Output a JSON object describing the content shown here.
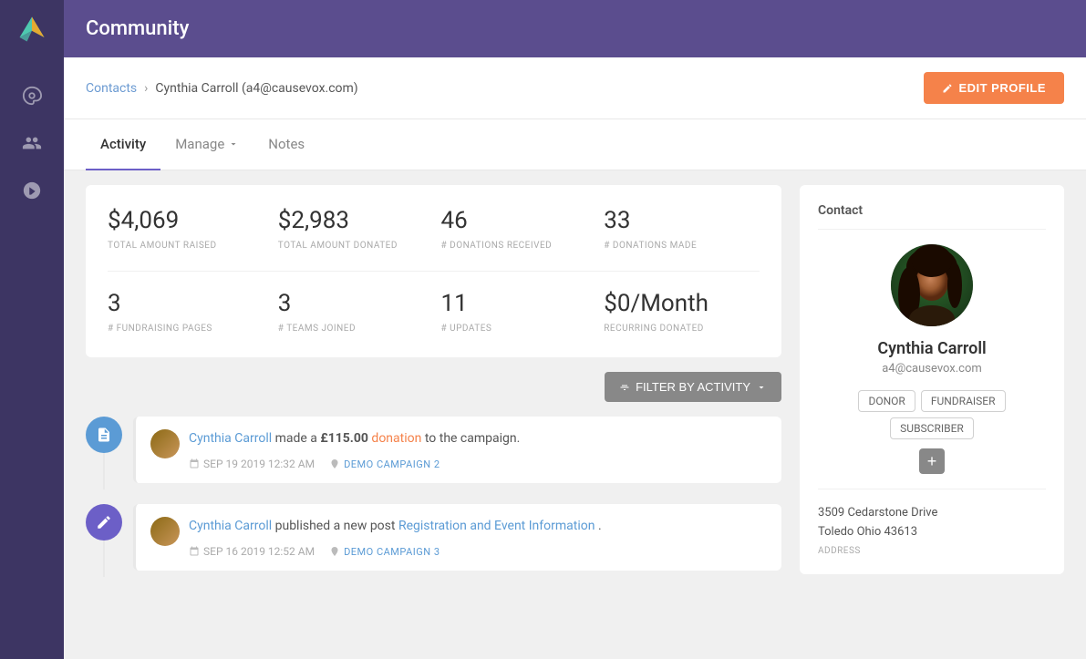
{
  "app": {
    "title": "Community"
  },
  "sidebar": {
    "nav_items": [
      {
        "name": "dashboard",
        "icon": "palette"
      },
      {
        "name": "community",
        "icon": "people"
      },
      {
        "name": "campaigns",
        "icon": "rocket"
      }
    ]
  },
  "breadcrumb": {
    "parent_label": "Contacts",
    "separator": "›",
    "current_label": "Cynthia Carroll (a4@causevox.com)"
  },
  "edit_profile_btn": "EDIT PROFILE",
  "tabs": [
    {
      "label": "Activity",
      "active": true
    },
    {
      "label": "Manage",
      "has_dropdown": true
    },
    {
      "label": "Notes"
    }
  ],
  "stats": {
    "row1": [
      {
        "value": "$4,069",
        "label": "TOTAL AMOUNT RAISED"
      },
      {
        "value": "$2,983",
        "label": "TOTAL AMOUNT DONATED"
      },
      {
        "value": "46",
        "label": "# DONATIONS RECEIVED"
      },
      {
        "value": "33",
        "label": "# DONATIONS MADE"
      }
    ],
    "row2": [
      {
        "value": "3",
        "label": "# FUNDRAISING PAGES"
      },
      {
        "value": "3",
        "label": "# TEAMS JOINED"
      },
      {
        "value": "11",
        "label": "# UPDATES"
      },
      {
        "value": "$0/Month",
        "label": "RECURRING DONATED"
      }
    ]
  },
  "filter_btn": "FILTER BY ACTIVITY",
  "activities": [
    {
      "type": "donation",
      "icon_type": "blue",
      "actor": "Cynthia Carroll",
      "text_pre": "made a",
      "amount": "£115.00",
      "text_mid": "donation",
      "text_post": "to the campaign.",
      "date": "SEP 19 2019 12:32 AM",
      "campaign": "DEMO CAMPAIGN 2"
    },
    {
      "type": "post",
      "icon_type": "purple",
      "actor": "Cynthia Carroll",
      "text_pre": "published a new post",
      "post_title": "Registration and Event Information",
      "text_post": ".",
      "date": "SEP 16 2019 12:52 AM",
      "campaign": "DEMO CAMPAIGN 3"
    }
  ],
  "contact": {
    "section_title": "Contact",
    "name": "Cynthia Carroll",
    "email": "a4@causevox.com",
    "tags": [
      "DONOR",
      "FUNDRAISER",
      "SUBSCRIBER"
    ],
    "add_tag_label": "+",
    "address_line1": "3509 Cedarstone Drive",
    "address_line2": "Toledo Ohio 43613",
    "address_label": "ADDRESS"
  }
}
